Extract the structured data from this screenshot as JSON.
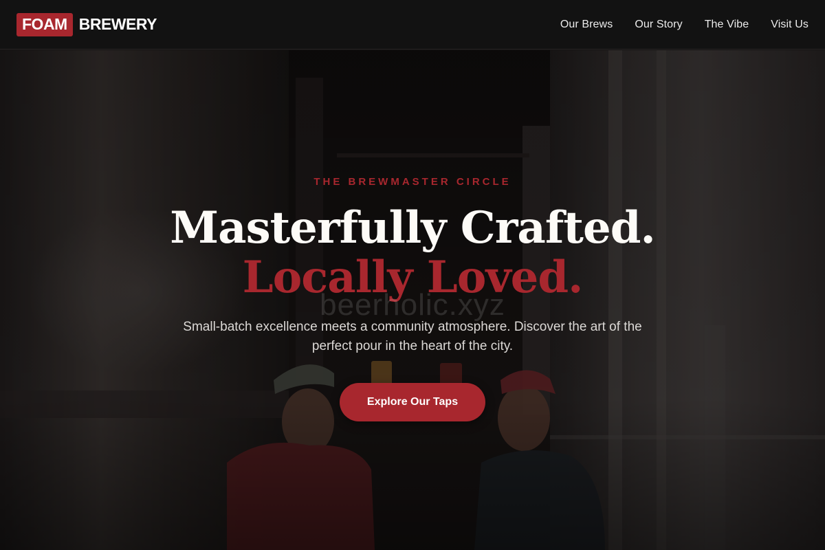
{
  "brand": {
    "badge": "FOAM",
    "name": "BREWERY",
    "accent_color": "#a8272e"
  },
  "nav": {
    "links": [
      {
        "label": "Our Brews"
      },
      {
        "label": "Our Story"
      },
      {
        "label": "The Vibe"
      },
      {
        "label": "Visit Us"
      }
    ]
  },
  "hero": {
    "eyebrow": "THE BREWMASTER CIRCLE",
    "headline_line1": "Masterfully Crafted.",
    "headline_line2": "Locally Loved.",
    "watermark": "beerholic.xyz",
    "subtitle": "Small-batch excellence meets a community atmosphere. Discover the art of the perfect pour in the heart of the city.",
    "cta_label": "Explore Our Taps",
    "background": "brewery-photo-two-men-toasting"
  }
}
